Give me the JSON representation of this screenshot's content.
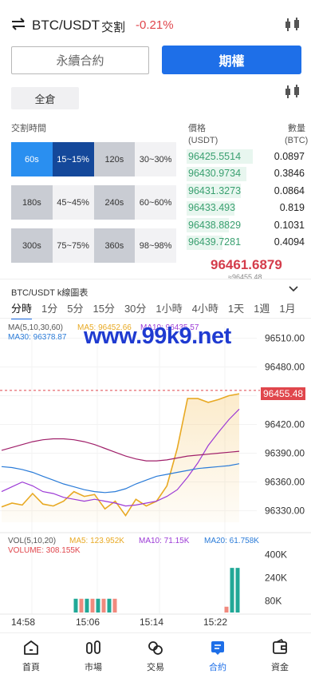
{
  "header": {
    "pair": "BTC/USDT",
    "trade_label": "交割",
    "change": "-0.21%"
  },
  "mode_buttons": {
    "perpetual": "永續合約",
    "options": "期權"
  },
  "margin_mode": "全倉",
  "delivery": {
    "section_label": "交割時間",
    "options": [
      {
        "time": "60s",
        "rate": "15~15%",
        "selected": true
      },
      {
        "time": "120s",
        "rate": "30~30%",
        "selected": false
      },
      {
        "time": "180s",
        "rate": "45~45%",
        "selected": false
      },
      {
        "time": "240s",
        "rate": "60~60%",
        "selected": false
      },
      {
        "time": "300s",
        "rate": "75~75%",
        "selected": false
      },
      {
        "time": "360s",
        "rate": "98~98%",
        "selected": false
      }
    ]
  },
  "orderbook": {
    "price_header": "價格",
    "price_unit": "(USDT)",
    "qty_header": "數量",
    "qty_unit": "(BTC)",
    "rows": [
      {
        "price": "96425.5514",
        "qty": "0.0897",
        "depth": 0.55
      },
      {
        "price": "96430.9734",
        "qty": "0.3846",
        "depth": 0.5
      },
      {
        "price": "96431.3273",
        "qty": "0.0864",
        "depth": 0.45
      },
      {
        "price": "96433.493",
        "qty": "0.819",
        "depth": 0.4
      },
      {
        "price": "96438.8829",
        "qty": "0.1031",
        "depth": 0.35
      },
      {
        "price": "96439.7281",
        "qty": "0.4094",
        "depth": 0.3
      }
    ],
    "last_price": "96461.6879",
    "mark_price": "≈96455.48"
  },
  "chart": {
    "title": "BTC/USDT k線圖表",
    "timeframes": [
      "分時",
      "1分",
      "5分",
      "15分",
      "30分",
      "1小時",
      "4小時",
      "1天",
      "1週",
      "1月"
    ],
    "selected_timeframe": "分時",
    "ma_header": "MA(5,10,30,60)",
    "ma5": "MA5: 96452.66",
    "ma10": "MA10: 96435.57",
    "ma30": "MA30: 96378.87",
    "watermark": "www.99k9.net",
    "current_price": "96455.48",
    "volume_header": "VOL(5,10,20)",
    "vol_ma5": "MA5: 123.952K",
    "vol_ma10": "MA10: 71.15K",
    "vol_ma20": "MA20: 61.758K",
    "volume": "VOLUME: 308.155K",
    "colors": {
      "ma5": "#e8a923",
      "ma10": "#9c3ad6",
      "ma30": "#2a7bd8",
      "ma60": "#a0206a",
      "up": "#21a897",
      "down": "#f08a7e"
    }
  },
  "chart_data": {
    "type": "line",
    "x": [
      "14:58",
      "15:06",
      "15:14",
      "15:22"
    ],
    "ylabel": "",
    "yticks": [
      96330.0,
      96360.0,
      96390.0,
      96420.0,
      96450.0,
      96480.0,
      96510.0
    ],
    "ylim": [
      96318,
      96522
    ],
    "series": [
      {
        "name": "MA5",
        "values": [
          96334,
          96338,
          96336,
          96348,
          96337,
          96335,
          96340,
          96350,
          96345,
          96347,
          96332,
          96340,
          96325,
          96342,
          96335,
          96340,
          96356,
          96395,
          96447,
          96447,
          96443,
          96446,
          96450,
          96452
        ]
      },
      {
        "name": "MA10",
        "values": [
          96350,
          96355,
          96360,
          96356,
          96350,
          96348,
          96344,
          96342,
          96340,
          96342,
          96340,
          96338,
          96335,
          96336,
          96338,
          96340,
          96345,
          96352,
          96365,
          96380,
          96398,
          96412,
          96425,
          96436
        ]
      },
      {
        "name": "MA30",
        "values": [
          96376,
          96375,
          96373,
          96370,
          96366,
          96362,
          96358,
          96355,
          96352,
          96350,
          96349,
          96350,
          96353,
          96358,
          96362,
          96366,
          96368,
          96370,
          96372,
          96374,
          96375,
          96376,
          96377,
          96379
        ]
      },
      {
        "name": "MA60",
        "values": [
          96393,
          96396,
          96399,
          96402,
          96404,
          96405,
          96405,
          96404,
          96402,
          96399,
          96395,
          96391,
          96387,
          96384,
          96382,
          96382,
          96383,
          96385,
          96387,
          96388,
          96389,
          96390,
          96391,
          96392
        ]
      }
    ],
    "volume": {
      "yticks": [
        "400K",
        "240K",
        "80K"
      ],
      "ylim": [
        0,
        430
      ],
      "values": [
        0,
        0,
        0,
        0,
        0,
        0,
        0,
        0,
        0,
        0,
        0,
        0,
        0,
        95,
        95,
        95,
        95,
        95,
        95,
        95,
        95,
        0,
        0,
        0,
        0,
        0,
        0,
        0,
        0,
        0,
        0,
        0,
        0,
        0,
        0,
        0,
        0,
        0,
        0,
        0,
        40,
        308,
        308
      ]
    }
  },
  "nav": [
    {
      "label": "首頁",
      "icon": "home-icon",
      "selected": false
    },
    {
      "label": "市場",
      "icon": "market-icon",
      "selected": false
    },
    {
      "label": "交易",
      "icon": "trade-icon",
      "selected": false
    },
    {
      "label": "合約",
      "icon": "contract-icon",
      "selected": true
    },
    {
      "label": "資金",
      "icon": "wallet-icon",
      "selected": false
    }
  ]
}
